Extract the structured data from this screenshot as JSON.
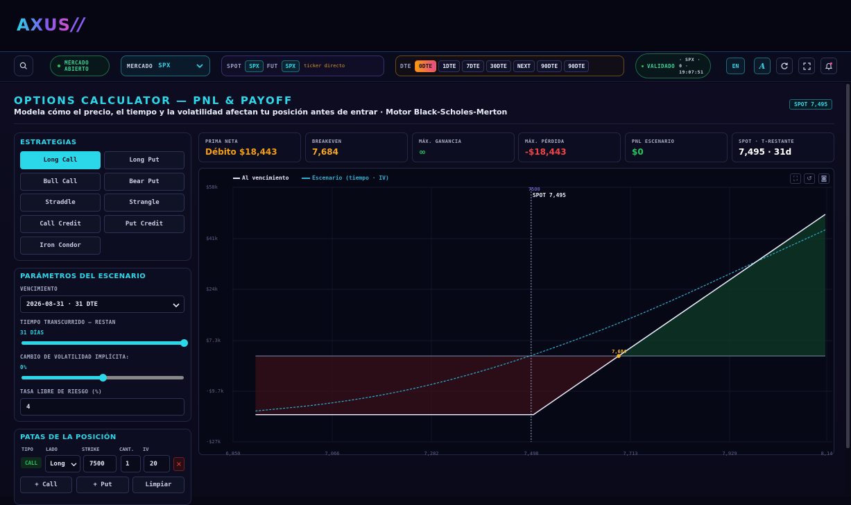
{
  "app": {
    "logo": "AXUS",
    "logo_slash": "//"
  },
  "toolbar": {
    "market_status": [
      "MERCADO",
      "ABIERTO"
    ],
    "market_label": "MERCADO",
    "market_value": "SPX",
    "spot_label": "SPOT",
    "spot_chip": "SPX",
    "fut_label": "FUT",
    "fut_chip": "SPX",
    "ticker_hint": "ticker directo",
    "dte_label": "DTE",
    "dte_options": [
      "0DTE",
      "1DTE",
      "7DTE",
      "30DTE",
      "NEXT",
      "90DTE",
      "90DTE"
    ],
    "dte_active": "0DTE",
    "validated_label": "VALIDADO",
    "validated_info": [
      "· SPX ·",
      "0 ·",
      "19:07:51"
    ],
    "lang": "EN",
    "font_icon": "A"
  },
  "header": {
    "title": "OPTIONS CALCULATOR — PNL & PAYOFF",
    "subtitle": "Modela cómo el precio, el tiempo y la volatilidad afectan tu posición antes de entrar · Motor Black-Scholes-Merton",
    "spot_badge": "SPOT 7,495"
  },
  "strategies": {
    "heading": "ESTRATEGIAS",
    "items": [
      "Long Call",
      "Long Put",
      "Bull Call",
      "Bear Put",
      "Straddle",
      "Strangle",
      "Call Credit",
      "Put Credit",
      "Iron Condor"
    ],
    "active": "Long Call"
  },
  "scenario": {
    "heading": "PARÁMETROS DEL ESCENARIO",
    "expiry_label": "VENCIMIENTO",
    "expiry_value": "2026-08-31 · 31 DTE",
    "time_label": "TIEMPO TRANSCURRIDO — RESTAN",
    "time_value": "31 DÍAS",
    "time_level": 1.0,
    "iv_label": "CAMBIO DE VOLATILIDAD IMPLÍCITA:",
    "iv_value": "0%",
    "iv_level": 0.5,
    "rate_label": "TASA LIBRE DE RIESGO (%)",
    "rate_value": "4"
  },
  "legs": {
    "heading": "PATAS DE LA POSICIÓN",
    "columns": [
      "TIPO",
      "LADO",
      "STRIKE",
      "CANT.",
      "IV"
    ],
    "row": {
      "type": "CALL",
      "side": "Long",
      "strike": "7500",
      "qty": "1",
      "iv": "20"
    },
    "add_call": "+ Call",
    "add_put": "+ Put",
    "clear": "Limpiar"
  },
  "stats": [
    {
      "label": "PRIMA NETA",
      "value": "Débito $18,443",
      "color": "#f59e0b"
    },
    {
      "label": "BREAKEVEN",
      "value": "7,684",
      "color": "#f5a623"
    },
    {
      "label": "MÁX. GANANCIA",
      "value": "∞",
      "color": "#22c55e"
    },
    {
      "label": "MÁX. PÉRDIDA",
      "value": "-$18,443",
      "color": "#ef4444"
    },
    {
      "label": "PNL ESCENARIO",
      "value": "$0",
      "color": "#22c55e"
    },
    {
      "label": "SPOT · T-RESTANTE",
      "value": "7,495 · 31d",
      "color": "#ffffff"
    }
  ],
  "chart_data": {
    "type": "line",
    "legend": [
      "Al vencimiento",
      "Escenario (tiempo · IV)"
    ],
    "x_ticks": [
      "6,850",
      "7,066",
      "7,282",
      "7,498",
      "7,713",
      "7,929",
      "8,14"
    ],
    "y_ticks": [
      "$58k",
      "$41k",
      "$24k",
      "$7.3k",
      "-$9.7k",
      "-$27k"
    ],
    "xlim": [
      6850,
      8145
    ],
    "ylim": [
      -27000,
      58000
    ],
    "strike_label": "7500",
    "spot_marker_label": "SPOT 7,495",
    "spot": 7495,
    "breakeven": 7684,
    "breakeven_label": "7,684",
    "series": [
      {
        "name": "Al vencimiento",
        "x": [
          6900,
          7500,
          7684,
          8130
        ],
        "y": [
          -18443,
          -18443,
          0,
          44500
        ]
      },
      {
        "name": "Escenario (tiempo · IV)",
        "x": [
          6900,
          7050,
          7200,
          7350,
          7495,
          7650,
          7800,
          7950,
          8130
        ],
        "y": [
          -17300,
          -15200,
          -11700,
          -6500,
          0,
          8200,
          17400,
          27600,
          39600
        ]
      }
    ]
  }
}
